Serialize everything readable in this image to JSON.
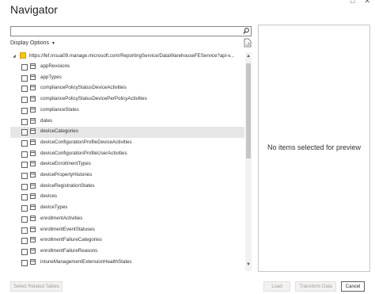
{
  "window": {
    "title": "Navigator",
    "controls": [
      "□",
      "✕"
    ]
  },
  "search": {
    "value": "",
    "placeholder": ""
  },
  "display_options": {
    "label": "Display Options",
    "caret": "▾"
  },
  "tree": {
    "root_url": "https://fef.msua09.manage.microsoft.com/ReportingService/DataWarehouseFEService?api-v...",
    "items": [
      {
        "label": "appRevisions",
        "selected": false
      },
      {
        "label": "appTypes",
        "selected": false
      },
      {
        "label": "compliancePolicyStatusDeviceActivities",
        "selected": false
      },
      {
        "label": "compliancePolicyStatusDevicePerPolicyActivities",
        "selected": false
      },
      {
        "label": "complianceStates",
        "selected": false
      },
      {
        "label": "dates",
        "selected": false
      },
      {
        "label": "deviceCategories",
        "selected": true
      },
      {
        "label": "deviceConfigurationProfileDeviceActivities",
        "selected": false
      },
      {
        "label": "deviceConfigurationProfileUserActivities",
        "selected": false
      },
      {
        "label": "deviceEnrollmentTypes",
        "selected": false
      },
      {
        "label": "devicePropertyHistories",
        "selected": false
      },
      {
        "label": "deviceRegistrationStates",
        "selected": false
      },
      {
        "label": "devices",
        "selected": false
      },
      {
        "label": "deviceTypes",
        "selected": false
      },
      {
        "label": "enrollmentActivities",
        "selected": false
      },
      {
        "label": "enrollmentEventStatuses",
        "selected": false
      },
      {
        "label": "enrollmentFailureCategories",
        "selected": false
      },
      {
        "label": "enrollmentFailureReasons",
        "selected": false
      },
      {
        "label": "intuneManagementExtensionHealthStates",
        "selected": false
      }
    ]
  },
  "preview": {
    "message": "No items selected for preview"
  },
  "buttons": {
    "select_related": "Select Related Tables",
    "load": "Load",
    "transform": "Transform Data",
    "cancel": "Cancel"
  },
  "colors": {
    "selected_row": "#e6e6e6",
    "folder": "#f2c811"
  }
}
